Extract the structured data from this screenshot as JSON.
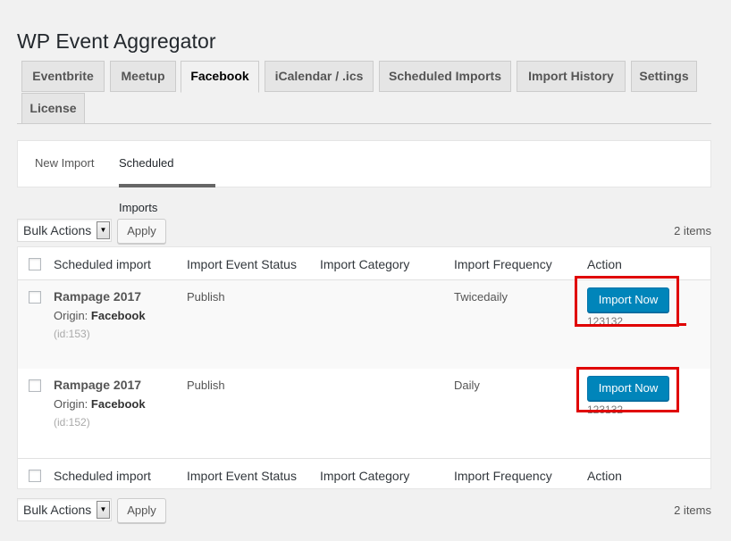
{
  "page": {
    "title": "WP Event Aggregator"
  },
  "tabs": [
    {
      "label": "Eventbrite",
      "active": false
    },
    {
      "label": "Meetup",
      "active": false
    },
    {
      "label": "Facebook",
      "active": true
    },
    {
      "label": "iCalendar / .ics",
      "active": false
    },
    {
      "label": "Scheduled Imports",
      "active": false
    },
    {
      "label": "Import History",
      "active": false
    },
    {
      "label": "Settings",
      "active": false
    },
    {
      "label": "License",
      "active": false
    }
  ],
  "subtabs": [
    {
      "label": "New Import",
      "active": false
    },
    {
      "label": "Scheduled Imports",
      "active": true
    }
  ],
  "tablenav": {
    "bulk_actions": "Bulk Actions",
    "apply": "Apply",
    "items_count": "2 items"
  },
  "columns": [
    "Scheduled import",
    "Import Event Status",
    "Import Category",
    "Import Frequency",
    "Action"
  ],
  "rows": [
    {
      "title": "Rampage 2017",
      "origin_label": "Origin:",
      "origin": "Facebook",
      "id": "(id:153)",
      "status": "Publish",
      "category": "",
      "frequency": "Twicedaily",
      "action_label": "Import Now",
      "action_sub": "123132"
    },
    {
      "title": "Rampage 2017",
      "origin_label": "Origin:",
      "origin": "Facebook",
      "id": "(id:152)",
      "status": "Publish",
      "category": "",
      "frequency": "Daily",
      "action_label": "Import Now",
      "action_sub": "123132"
    }
  ],
  "colors": {
    "primary_button": "#0085ba",
    "highlight": "#e00000"
  }
}
